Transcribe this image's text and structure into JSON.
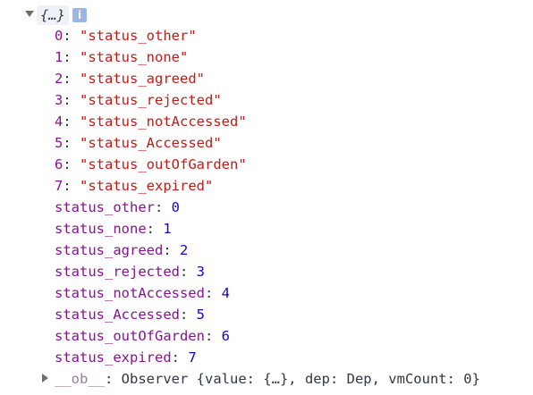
{
  "header": {
    "label": "{…}",
    "info_icon_glyph": "i"
  },
  "array_entries": [
    {
      "index": "0",
      "value": "\"status_other\""
    },
    {
      "index": "1",
      "value": "\"status_none\""
    },
    {
      "index": "2",
      "value": "\"status_agreed\""
    },
    {
      "index": "3",
      "value": "\"status_rejected\""
    },
    {
      "index": "4",
      "value": "\"status_notAccessed\""
    },
    {
      "index": "5",
      "value": "\"status_Accessed\""
    },
    {
      "index": "6",
      "value": "\"status_outOfGarden\""
    },
    {
      "index": "7",
      "value": "\"status_expired\""
    }
  ],
  "named_entries": [
    {
      "key": "status_other",
      "value": "0"
    },
    {
      "key": "status_none",
      "value": "1"
    },
    {
      "key": "status_agreed",
      "value": "2"
    },
    {
      "key": "status_rejected",
      "value": "3"
    },
    {
      "key": "status_notAccessed",
      "value": "4"
    },
    {
      "key": "status_Accessed",
      "value": "5"
    },
    {
      "key": "status_outOfGarden",
      "value": "6"
    },
    {
      "key": "status_expired",
      "value": "7"
    }
  ],
  "observer_row": {
    "key": "__ob__",
    "value": "Observer {value: {…}, dep: Dep, vmCount: 0}"
  },
  "colors": {
    "key": "#881391",
    "string": "#c41a16",
    "number": "#1c00cf"
  }
}
